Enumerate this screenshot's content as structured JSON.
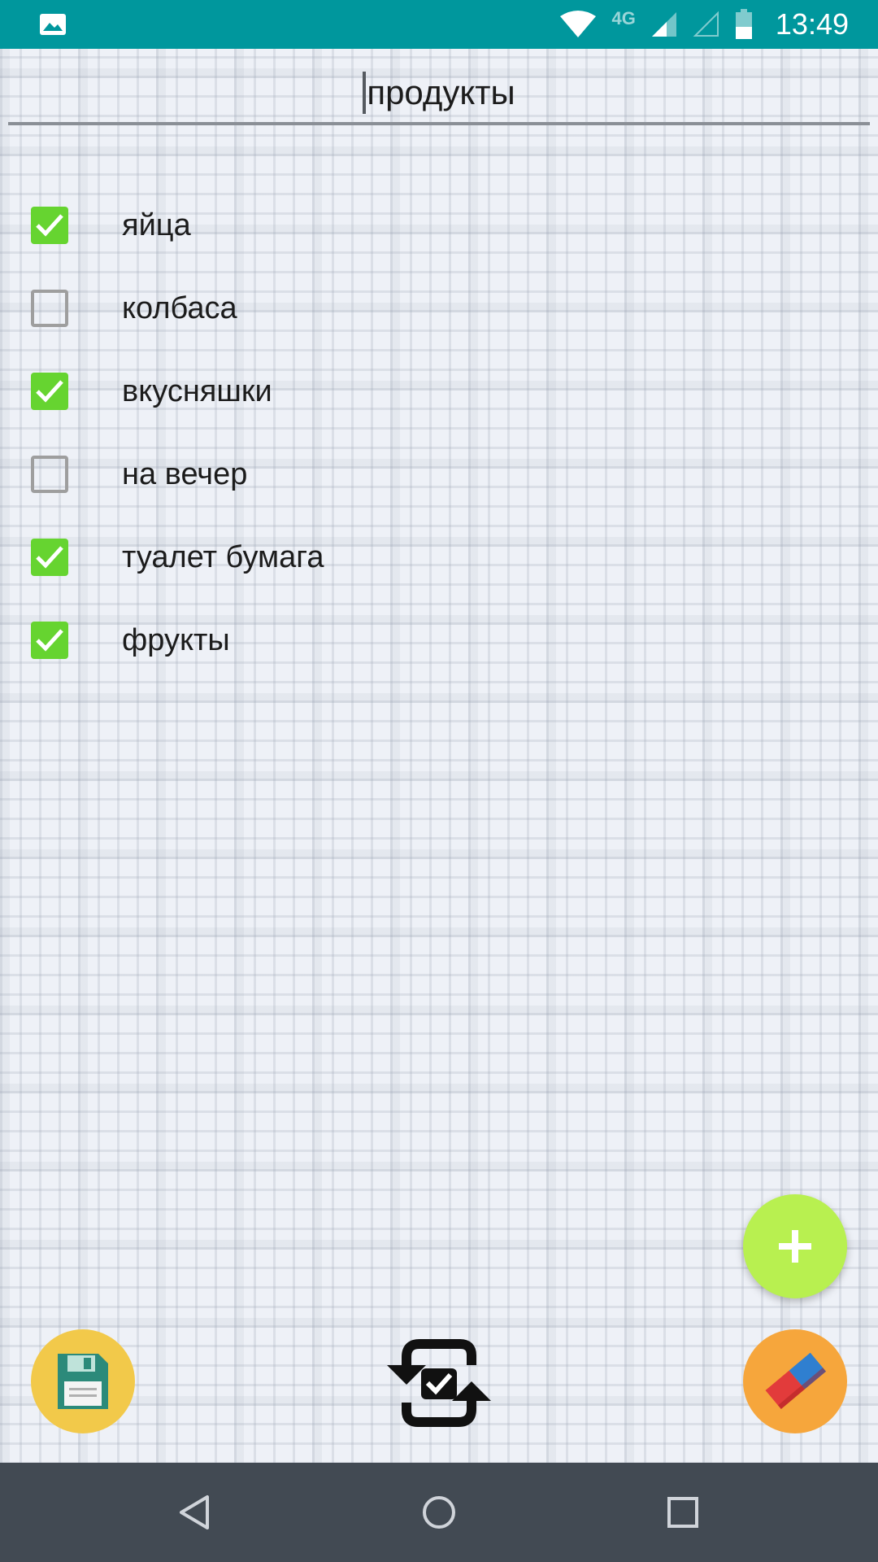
{
  "status_bar": {
    "time": "13:49",
    "network": "4G",
    "icons": [
      "gallery-icon",
      "wifi-icon",
      "signal-icon",
      "signal-empty-icon",
      "battery-icon"
    ],
    "color": "#00979d"
  },
  "list_title": {
    "value": "продукты"
  },
  "items": [
    {
      "label": "яйца",
      "checked": true
    },
    {
      "label": "колбаса",
      "checked": false
    },
    {
      "label": "вкусняшки",
      "checked": true
    },
    {
      "label": "на вечер",
      "checked": false
    },
    {
      "label": "туалет бумага",
      "checked": true
    },
    {
      "label": "фрукты",
      "checked": true
    }
  ],
  "actions": {
    "add_icon": "plus-icon",
    "save_icon": "floppy-disk-icon",
    "sync_icon": "sync-check-icon",
    "erase_icon": "eraser-icon"
  },
  "nav": {
    "icons": [
      "back-icon",
      "home-icon",
      "recents-icon"
    ]
  },
  "colors": {
    "checked": "#66d430",
    "add_button": "#b8f050",
    "save_button": "#f2c94a",
    "erase_button": "#f6a63c",
    "nav_bar": "#424a53"
  }
}
